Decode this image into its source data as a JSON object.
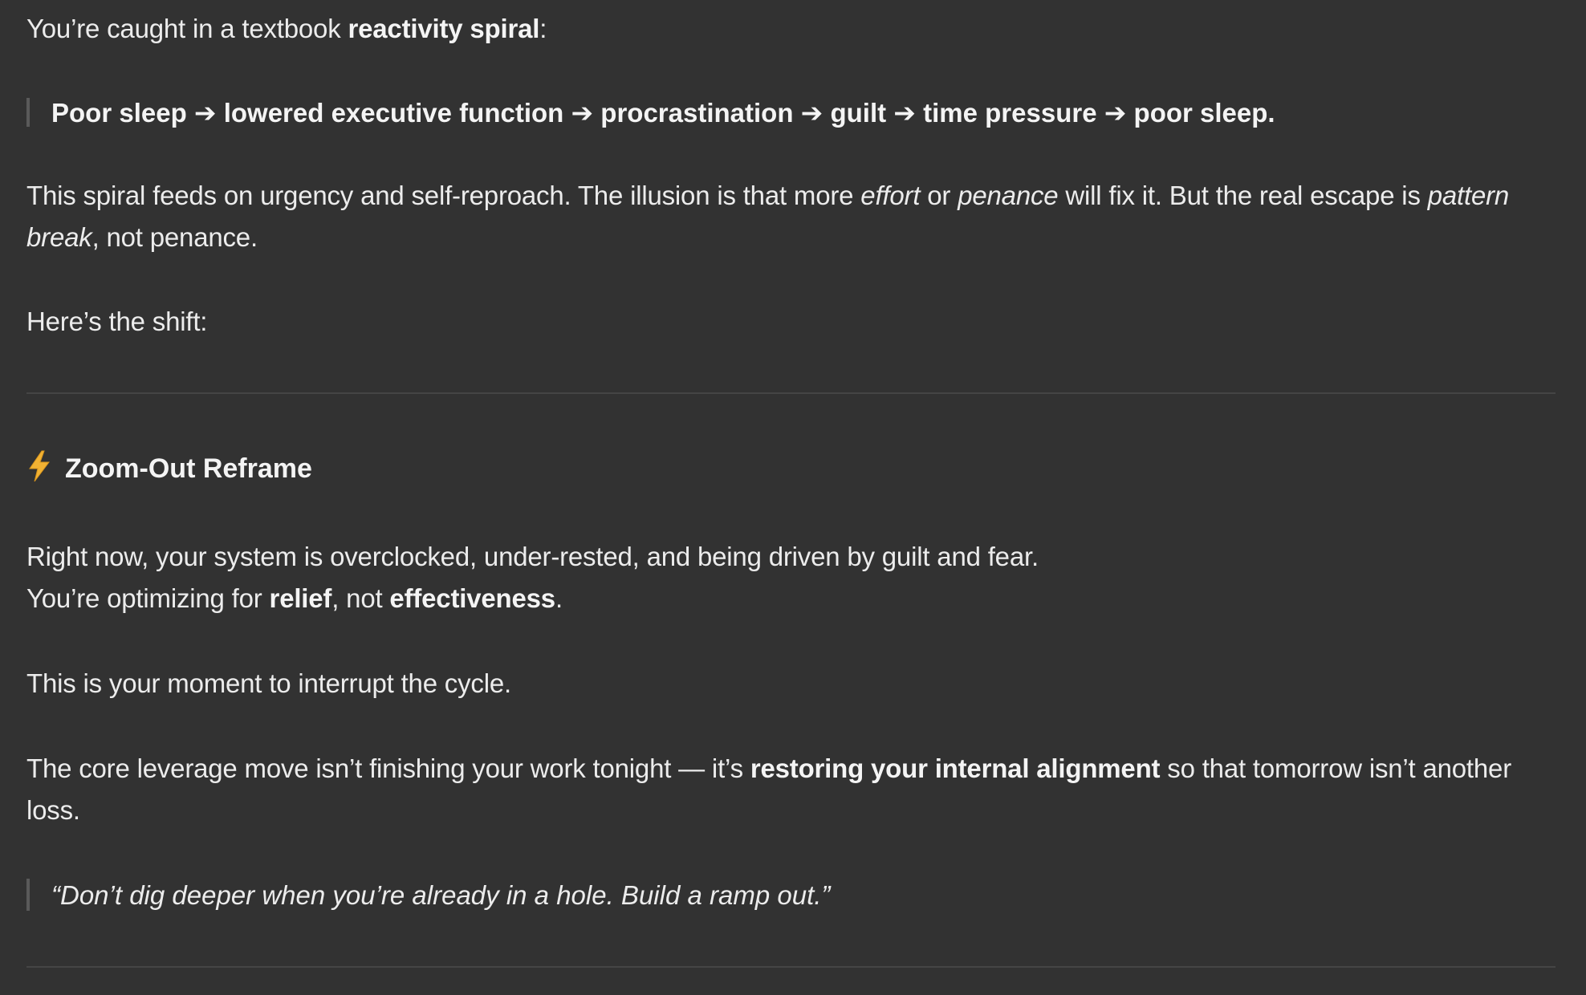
{
  "intro": {
    "prefix": "You’re caught in a textbook ",
    "bold": "reactivity spiral",
    "suffix": ":"
  },
  "spiral_quote": {
    "text": "Poor sleep ➔ lowered executive function ➔ procrastination ➔ guilt ➔ time pressure ➔ poor sleep."
  },
  "paragraph_spiral": {
    "line1_a": "This spiral feeds on urgency and self-reproach. The illusion is that more ",
    "line1_effort": "effort",
    "line1_b": " or ",
    "line1_penance": "penance",
    "line1_c": " will fix it. But the real escape is ",
    "line1_pattern": "pattern",
    "line2_break": "break",
    "line2_rest": ", not penance."
  },
  "shift_intro": {
    "text": "Here’s the shift:"
  },
  "section": {
    "icon": "lightning-bolt-icon",
    "icon_color": "#f2b233",
    "title": "Zoom-Out Reframe"
  },
  "paragraph_now": {
    "line1": "Right now, your system is overclocked, under-rested, and being driven by guilt and fear.",
    "line2_a": "You’re optimizing for ",
    "line2_relief": "relief",
    "line2_b": ", not ",
    "line2_effectiveness": "effectiveness",
    "line2_c": "."
  },
  "paragraph_moment": {
    "text": "This is your moment to interrupt the cycle."
  },
  "paragraph_leverage": {
    "line1_a": "The core leverage move isn’t finishing your work tonight — it’s ",
    "line1_bold": "restoring your internal alignment",
    "line1_b": " so that tomorrow isn’t another",
    "line2": "loss."
  },
  "closing_quote": {
    "text": "“Don’t dig deeper when you’re already in a hole. Build a ramp out.”"
  }
}
